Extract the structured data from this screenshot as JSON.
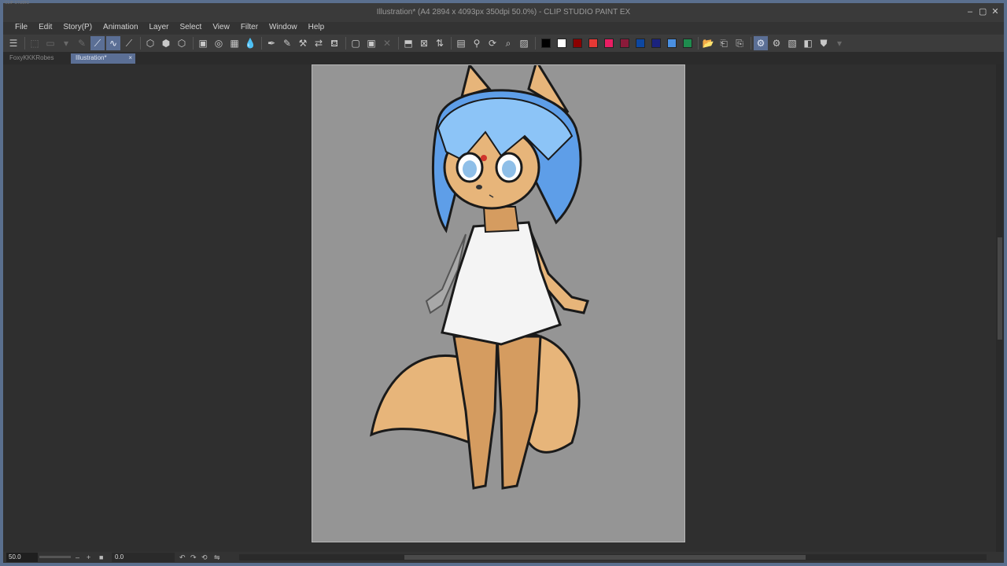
{
  "window": {
    "title": "Illustration* (A4 2894 x 4093px 350dpi 50.0%) - CLIP STUDIO PAINT EX",
    "app_tag": "CLIP STUDIO"
  },
  "menu": [
    "File",
    "Edit",
    "Story(P)",
    "Animation",
    "Layer",
    "Select",
    "View",
    "Filter",
    "Window",
    "Help"
  ],
  "tabs": [
    {
      "label": "FoxyKKKRobes",
      "active": false
    },
    {
      "label": "Illustration*",
      "active": true
    }
  ],
  "palette_colors": [
    "#000000",
    "#ffffff",
    "#8b0000",
    "#e53935",
    "#e91e63",
    "#8b1a3a",
    "#0d47a1",
    "#1a237e",
    "#4a90e2",
    "#1e8c4e"
  ],
  "status": {
    "zoom": "50.0",
    "angle": "0.0"
  },
  "icons": {
    "menu": "hamburger-icon",
    "close": "close-icon",
    "minimize": "minimize-icon",
    "maximize": "maximize-icon"
  }
}
